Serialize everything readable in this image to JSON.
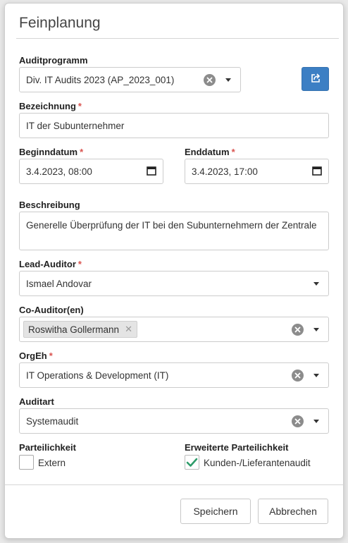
{
  "dialog": {
    "title": "Feinplanung"
  },
  "auditprogramm": {
    "label": "Auditprogramm",
    "value": "Div. IT Audits 2023 (AP_2023_001)"
  },
  "bezeichnung": {
    "label": "Bezeichnung",
    "required": "*",
    "value": "IT der Subunternehmer"
  },
  "beginndatum": {
    "label": "Beginndatum",
    "required": "*",
    "value": "3.4.2023, 08:00"
  },
  "enddatum": {
    "label": "Enddatum",
    "required": "*",
    "value": "3.4.2023, 17:00"
  },
  "beschreibung": {
    "label": "Beschreibung",
    "value": "Generelle Überprüfung der IT bei den Subunternehmern der Zentrale"
  },
  "lead_auditor": {
    "label": "Lead-Auditor",
    "required": "*",
    "value": "Ismael Andovar"
  },
  "co_auditoren": {
    "label": "Co-Auditor(en)",
    "chips": [
      "Roswitha Gollermann"
    ]
  },
  "orgeh": {
    "label": "OrgEh",
    "required": "*",
    "value": "IT Operations & Development (IT)"
  },
  "auditart": {
    "label": "Auditart",
    "value": "Systemaudit"
  },
  "parteilichkeit": {
    "label": "Parteilichkeit",
    "option": "Extern",
    "checked": false
  },
  "erweiterte_parteilichkeit": {
    "label": "Erweiterte Parteilichkeit",
    "option": "Kunden-/Lieferantenaudit",
    "checked": true
  },
  "footer": {
    "save_label": "Speichern",
    "cancel_label": "Abbrechen"
  },
  "colors": {
    "primary": "#3c7fc4",
    "required": "#d9534f",
    "check": "#2e9c6a"
  }
}
